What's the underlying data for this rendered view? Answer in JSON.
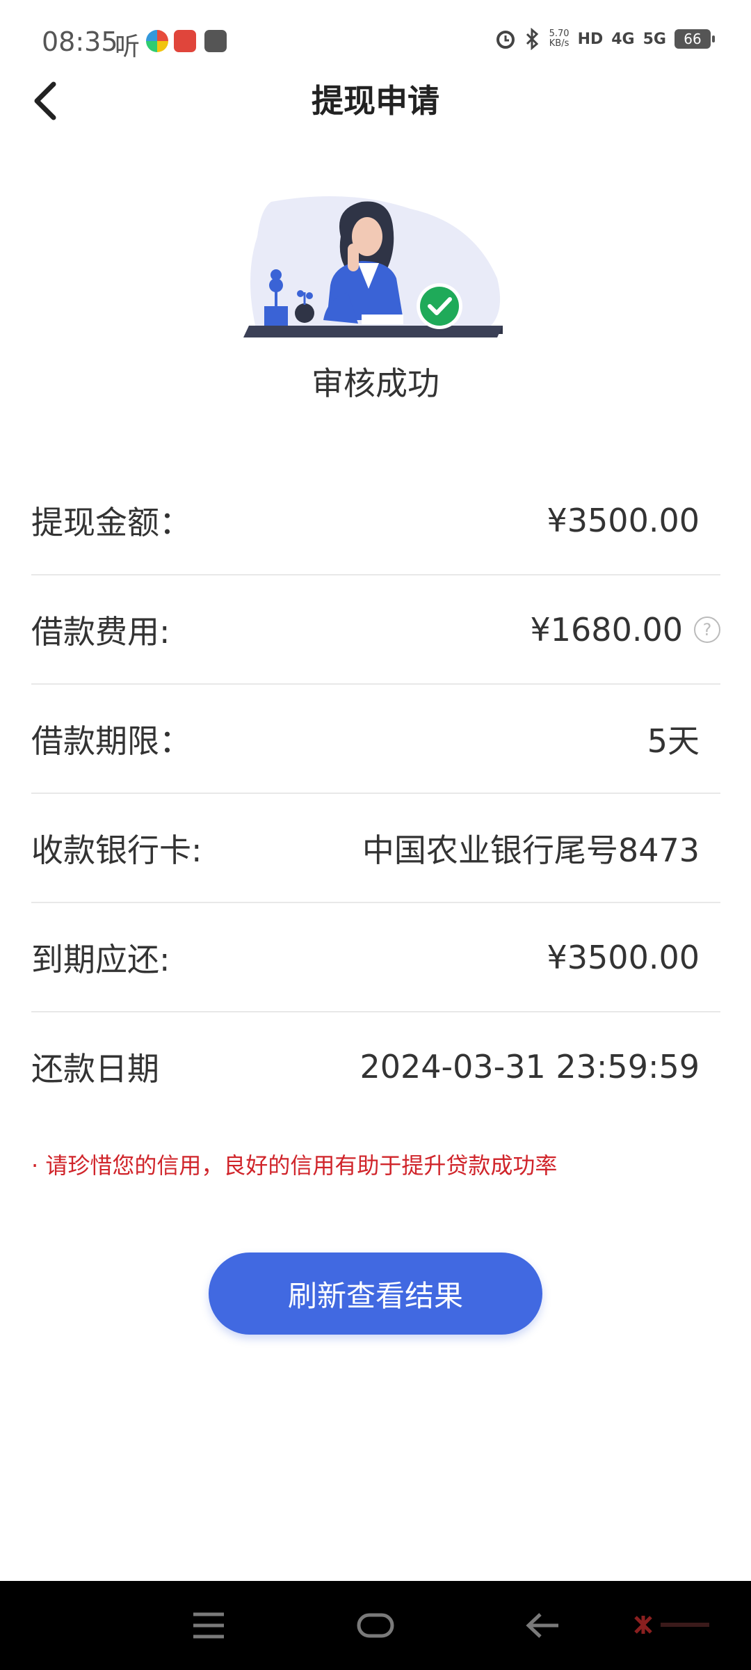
{
  "status_bar": {
    "time": "08:35",
    "listen_label": "听",
    "speed_value": "5.70",
    "speed_unit": "KB/s",
    "hd_tag": "HD",
    "net_4g": "4G",
    "net_5g": "5G",
    "battery": "66"
  },
  "header": {
    "title": "提现申请"
  },
  "result": {
    "status": "审核成功"
  },
  "info_rows": [
    {
      "label": "提现金额：",
      "value": "¥3500.00"
    },
    {
      "label": "借款费用:",
      "value": "¥1680.00"
    },
    {
      "label": "借款期限：",
      "value": "5天"
    },
    {
      "label": "收款银行卡:",
      "value": "中国农业银行尾号8473"
    },
    {
      "label": "到期应还:",
      "value": "¥3500.00"
    },
    {
      "label": "还款日期",
      "value": "2024-03-31 23:59:59"
    }
  ],
  "notice": "· 请珍惜您的信用，良好的信用有助于提升贷款成功率",
  "button": {
    "refresh_label": "刷新查看结果"
  },
  "colors": {
    "accent": "#4169e1",
    "notice": "#d0242a",
    "success": "#1faa59"
  },
  "icons": {
    "back": "back-arrow-icon",
    "help": "question-circle-icon",
    "success": "check-circle-icon"
  }
}
